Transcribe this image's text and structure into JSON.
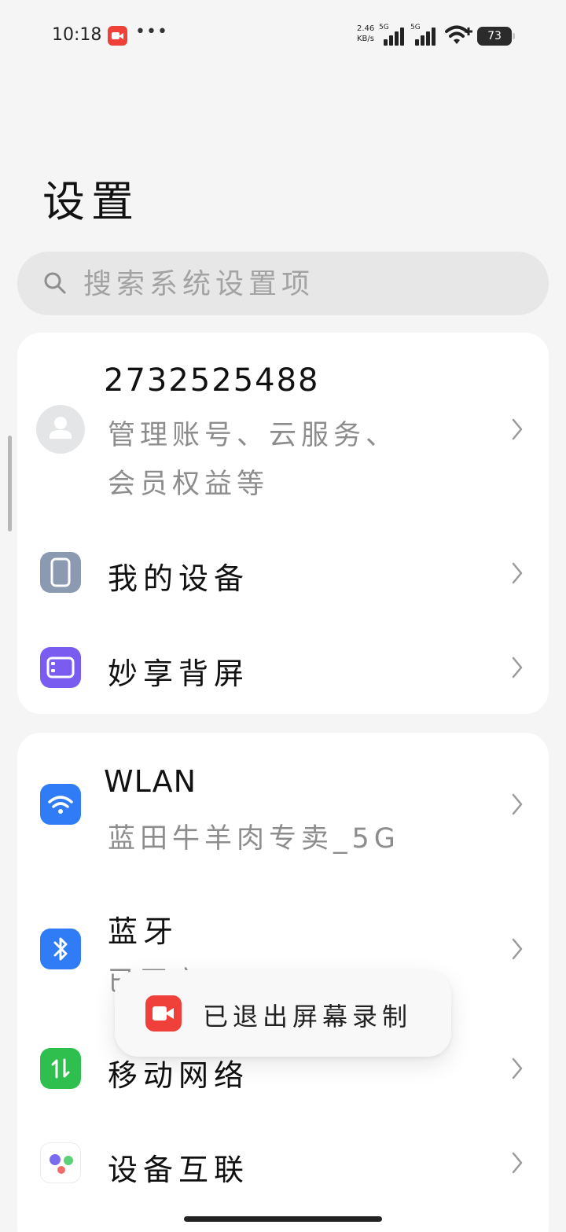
{
  "status_bar": {
    "time": "10:18",
    "more": "•••",
    "speed_value": "2.46",
    "speed_unit": "KB/s",
    "sim1_tag": "5G",
    "sim2_tag": "5G",
    "battery": "73"
  },
  "page": {
    "title": "设置"
  },
  "search": {
    "placeholder": "搜索系统设置项"
  },
  "account": {
    "name": "2732525488",
    "desc_line1": "管理账号、云服务、",
    "desc_line2": "会员权益等"
  },
  "group1": {
    "items": [
      {
        "label": "我的设备",
        "icon": "my-device-icon",
        "color": "#8b9ab1"
      },
      {
        "label": "妙享背屏",
        "icon": "rear-screen-icon",
        "color": "#7a5cf0"
      }
    ]
  },
  "group2": {
    "wlan": {
      "label": "WLAN",
      "value": "蓝田牛羊肉专卖_5G",
      "color": "#2f7cf6"
    },
    "bluetooth": {
      "label": "蓝牙",
      "value": "已开启",
      "color": "#2f7cf6"
    },
    "mobile": {
      "label": "移动网络",
      "color": "#2fbf4f"
    },
    "interconnect": {
      "label": "设备互联"
    }
  },
  "toast": {
    "text": "已退出屏幕录制",
    "color": "#f0403a"
  }
}
